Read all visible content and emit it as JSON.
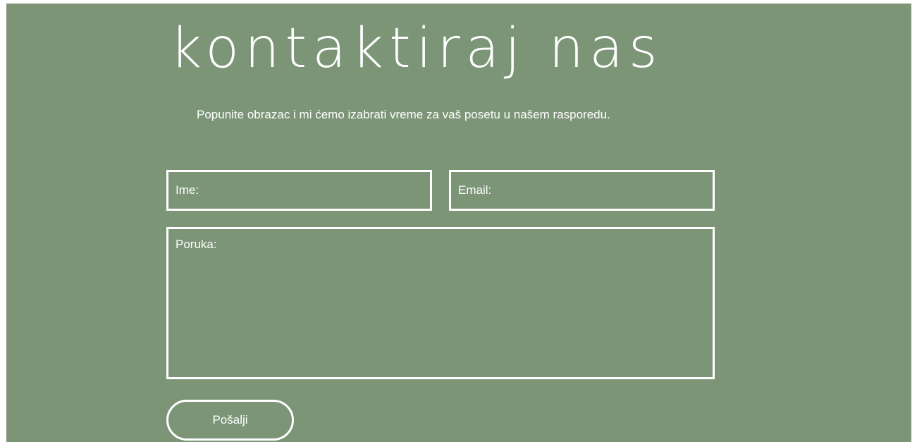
{
  "contact": {
    "title": "kontaktiraj nas",
    "subtitle": "Popunite obrazac i mi ćemo izabrati vreme za vaš posetu u našem rasporedu.",
    "form": {
      "name_placeholder": "Ime:",
      "email_placeholder": "Email:",
      "message_placeholder": "Poruka:",
      "submit_label": "Pošalji"
    }
  },
  "colors": {
    "background": "#7c9577",
    "foreground": "#ffffff"
  }
}
